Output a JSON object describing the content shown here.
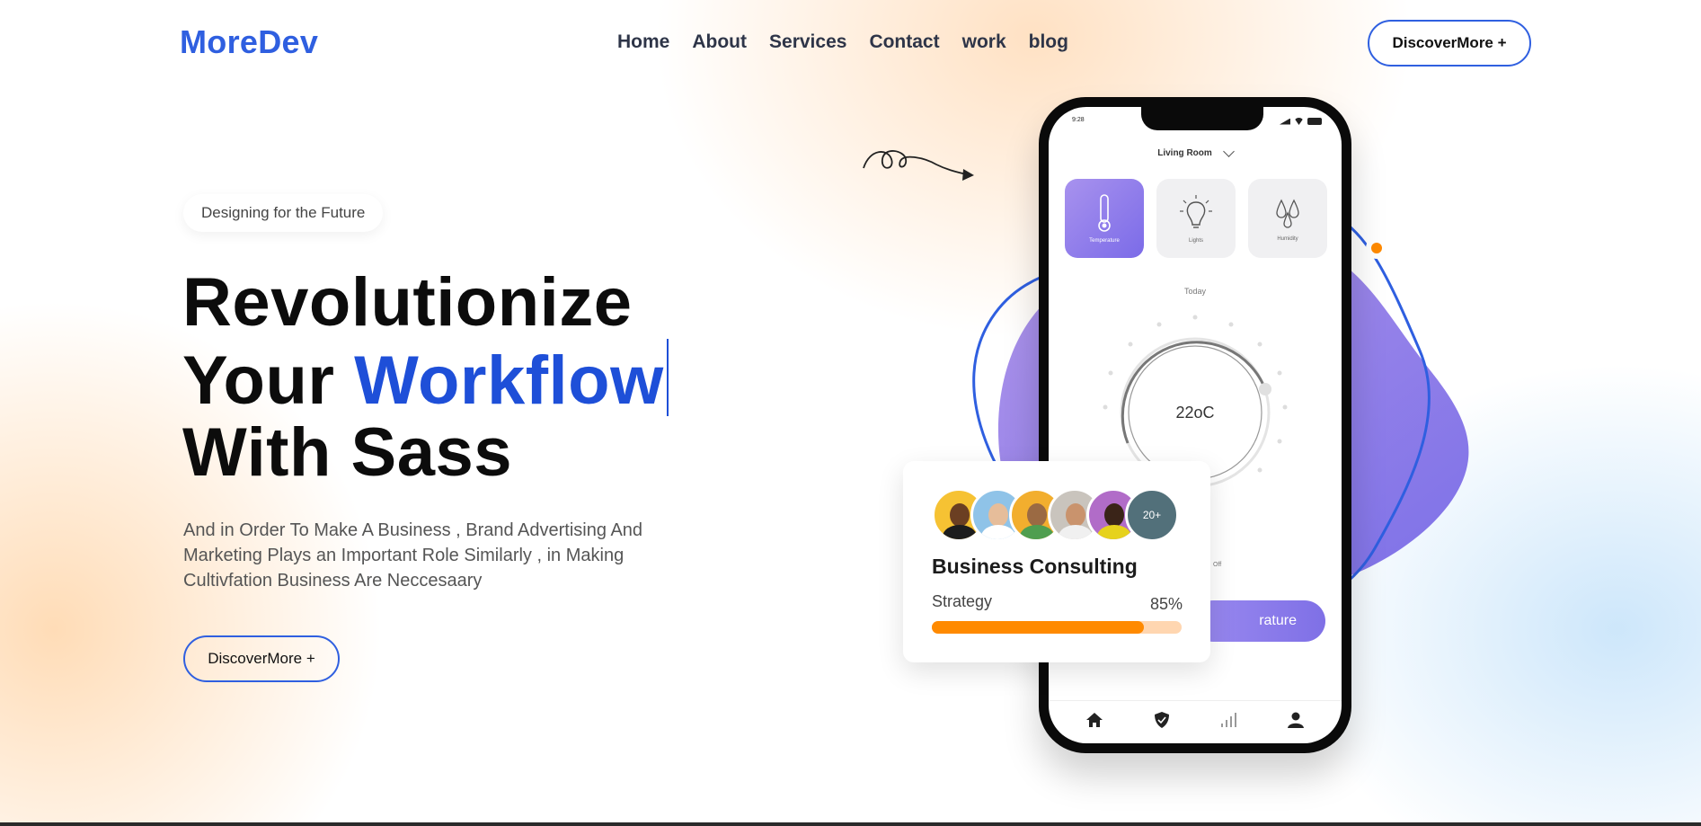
{
  "brand": {
    "logo": "MoreDev",
    "accent_color": "#2f5fe0"
  },
  "nav": {
    "items": [
      {
        "label": "Home"
      },
      {
        "label": "About"
      },
      {
        "label": "Services"
      },
      {
        "label": "Contact"
      },
      {
        "label": "work"
      },
      {
        "label": "blog"
      }
    ]
  },
  "header": {
    "cta_label": "DiscoverMore +"
  },
  "hero": {
    "tag": "Designing for the Future",
    "headline_line1": "Revolutionize",
    "headline_line2_plain": "Your ",
    "headline_line2_accent": "Workflow",
    "headline_line3": "With Sass",
    "description_lines": [
      "And in Order To Make A Business , Brand Advertising And",
      "Marketing Plays an Important Role Similarly , in Making",
      "Cultivfation Business Are Neccesaary"
    ],
    "cta_label": "DiscoverMore +"
  },
  "phone": {
    "status_time": "9:28",
    "room": "Living Room",
    "tiles": [
      {
        "label": "Temperature",
        "icon": "thermometer-icon",
        "active": true
      },
      {
        "label": "Lights",
        "icon": "lightbulb-icon",
        "active": false
      },
      {
        "label": "Humidity",
        "icon": "humidity-icon",
        "active": false
      }
    ],
    "day": "Today",
    "temperature": "22oC",
    "off_label": "Off",
    "button_label": "rature",
    "tab_icons": [
      "home-icon",
      "shield-icon",
      "signal-bars-icon",
      "user-icon"
    ]
  },
  "card": {
    "avatar_more": "20+",
    "title": "Business Consulting",
    "metric_label": "Strategy",
    "metric_percent_text": "85%",
    "metric_value": 0.85,
    "bar_color": "#ff8a00",
    "track_color": "#ffd6b0"
  }
}
